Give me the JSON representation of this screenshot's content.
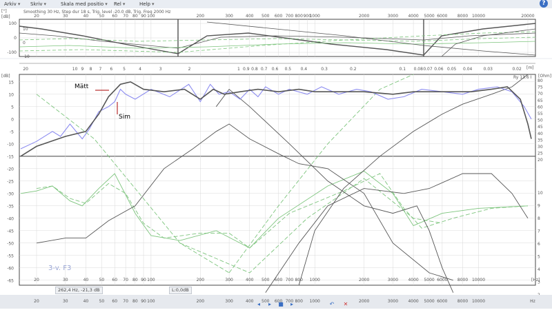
{
  "menubar": {
    "items": [
      {
        "label": "Arkiv",
        "caret": "▾"
      },
      {
        "label": "Skriv",
        "caret": "▾"
      },
      {
        "label": "Skala med positio",
        "caret": "▾"
      },
      {
        "label": "Rel",
        "caret": "▾"
      },
      {
        "label": "Help",
        "caret": "▾"
      }
    ],
    "help_icon": "?"
  },
  "phase_panel": {
    "info_text": "Smoothing 30 Hz, Step dur 18 s, Trig. level -20.0 dB, Trig. Freq 2000 Hz",
    "unit_left": "[°]",
    "unit_right": "[dB]",
    "y_ticks": [
      "100",
      "0",
      "-100"
    ],
    "y_ticks_right": [
      "10",
      "0",
      "-10"
    ],
    "x_ticks": [
      "20",
      "30",
      "40",
      "50",
      "60",
      "70",
      "80",
      "90",
      "100",
      "200",
      "300",
      "400",
      "500",
      "600",
      "700",
      "800",
      "900",
      "1000",
      "2000",
      "3000",
      "4000",
      "5000",
      "6000",
      "8000",
      "10000",
      "20000"
    ]
  },
  "wavelength_axis": {
    "ticks": [
      "20",
      "10",
      "9",
      "8",
      "7",
      "6",
      "5",
      "4",
      "3",
      "2",
      "1",
      "0.9",
      "0.8",
      "0.7",
      "0.6",
      "0.5",
      "0.4",
      "0.3",
      "0.2",
      "0.1",
      "0.08",
      "0.07",
      "0.06",
      "0.05",
      "0.04",
      "0.03",
      "0.02"
    ],
    "unit": "[m]"
  },
  "mag_panel": {
    "unit_left": "[dB]",
    "unit_right": "[Ohm]",
    "y_ticks": [
      "15",
      "10",
      "5",
      "0",
      "-5",
      "-10",
      "-15",
      "-20",
      "-25",
      "-30",
      "-35",
      "-40",
      "-45",
      "-50",
      "-55",
      "-60",
      "-65"
    ],
    "right_ticks_top": [
      "80",
      "75",
      "70",
      "65",
      "60",
      "55",
      "50",
      "45",
      "40",
      "35",
      "30",
      "25",
      "20"
    ],
    "right_ticks_bottom": [
      "10",
      "9",
      "8",
      "7",
      "6",
      "5",
      "4",
      "3",
      "2"
    ],
    "x_ticks": [
      "20",
      "30",
      "40",
      "50",
      "60",
      "70",
      "80",
      "90",
      "100",
      "200",
      "300",
      "400",
      "500",
      "600",
      "700",
      "800",
      "1000",
      "2000",
      "3000",
      "4000",
      "5000",
      "6000",
      "8000",
      "10000"
    ],
    "x_unit": "[Hz]",
    "corner_label": "Ry 13.6 I",
    "label_measured": "Mätt",
    "label_sim": "Sim",
    "watermark": "3-v. F3",
    "cursor_readout": "262,4 Hz, -21,3 dB",
    "offset_readout": "L:0,0dB",
    "bottom_x_ticks": [
      "20",
      "30",
      "40",
      "50",
      "60",
      "70",
      "80",
      "90",
      "100",
      "200",
      "300",
      "400",
      "500",
      "600",
      "700",
      "800",
      "1000",
      "2000",
      "3000",
      "4000",
      "5000",
      "6000",
      "8000",
      "10000",
      "Hz"
    ]
  },
  "colors": {
    "measured": "#8c8cf0",
    "sim": "#555555",
    "component": "#7cc47c",
    "grid": "#d8d8d8",
    "help": "#3a6fc4"
  }
}
